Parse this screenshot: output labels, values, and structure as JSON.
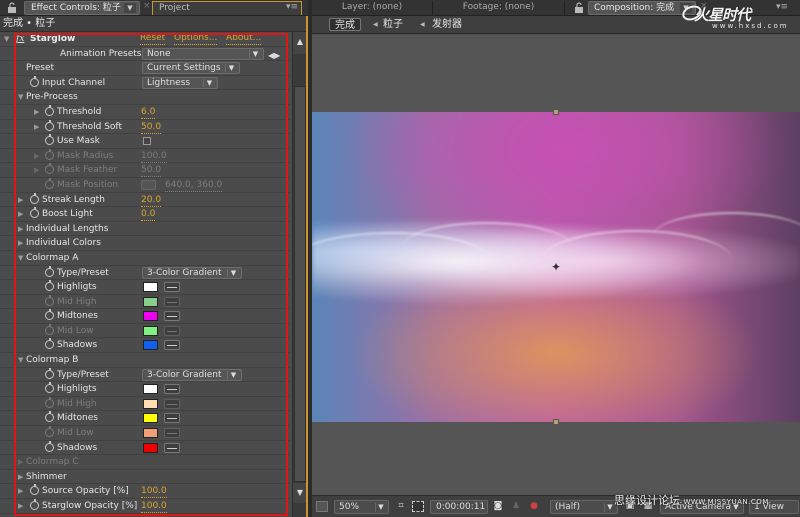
{
  "left_panel": {
    "tabs": [
      {
        "label": "Effect Controls: 粒子",
        "active": true
      },
      {
        "label": "Project",
        "active": false
      }
    ],
    "subtitle": "完成 • 粒子",
    "effect": {
      "name": "Starglow",
      "icon": "fx-icon",
      "links": {
        "reset": "Reset",
        "options": "Options...",
        "about": "About..."
      },
      "animation_presets": {
        "label": "Animation Presets:",
        "value": "None"
      },
      "preset": {
        "label": "Preset",
        "value": "Current Settings"
      },
      "input_channel": {
        "label": "Input Channel",
        "value": "Lightness"
      },
      "pre_process": {
        "label": "Pre-Process",
        "threshold": {
          "label": "Threshold",
          "value": "6.0"
        },
        "threshold_soft": {
          "label": "Threshold Soft",
          "value": "50.0"
        },
        "use_mask": {
          "label": "Use Mask",
          "checked": false
        },
        "mask_radius": {
          "label": "Mask Radius",
          "value": "100.0"
        },
        "mask_feather": {
          "label": "Mask Feather",
          "value": "50.0"
        },
        "mask_position": {
          "label": "Mask Position",
          "value": "640.0, 360.0"
        }
      },
      "streak_length": {
        "label": "Streak Length",
        "value": "20.0"
      },
      "boost_light": {
        "label": "Boost Light",
        "value": "0.0"
      },
      "individual_lengths": "Individual Lengths",
      "individual_colors": "Individual Colors",
      "colormap_a": {
        "label": "Colormap A",
        "type_preset": {
          "label": "Type/Preset",
          "value": "3-Color Gradient"
        },
        "highlights": {
          "label": "Highligts",
          "color": "#ffffff"
        },
        "mid_high": {
          "label": "Mid High",
          "color": "#88d08c"
        },
        "midtones": {
          "label": "Midtones",
          "color": "#f000f0"
        },
        "mid_low": {
          "label": "Mid Low",
          "color": "#80f080"
        },
        "shadows": {
          "label": "Shadows",
          "color": "#1060f0"
        }
      },
      "colormap_b": {
        "label": "Colormap B",
        "type_preset": {
          "label": "Type/Preset",
          "value": "3-Color Gradient"
        },
        "highlights": {
          "label": "Highligts",
          "color": "#ffffff"
        },
        "mid_high": {
          "label": "Mid High",
          "color": "#ffdcb4"
        },
        "midtones": {
          "label": "Midtones",
          "color": "#ffff00"
        },
        "mid_low": {
          "label": "Mid Low",
          "color": "#f0a078"
        },
        "shadows": {
          "label": "Shadows",
          "color": "#f00000"
        }
      },
      "colormap_c": "Colormap C",
      "shimmer": "Shimmer",
      "source_opacity": {
        "label": "Source Opacity [%]",
        "value": "100.0"
      },
      "starglow_opacity": {
        "label": "Starglow Opacity [%]",
        "value": "100.0"
      }
    }
  },
  "right_panel": {
    "tabs": [
      {
        "label": "Layer: (none)"
      },
      {
        "label": "Footage: (none)"
      },
      {
        "label": "Composition: 完成",
        "active": true
      }
    ],
    "breadcrumbs": [
      "完成",
      "粒子",
      "发射器"
    ],
    "watermark": {
      "brand": "火星时代",
      "url": "www.hxsd.com"
    },
    "footer_watermark": {
      "text": "思缘设计论坛",
      "url": "WWW.MISSYUAN.COM"
    },
    "toolbar": {
      "zoom": "50%",
      "timecode": "0:00:00:11",
      "resolution": "(Half)",
      "camera": "Active Camera",
      "views": "1 View"
    }
  },
  "colors": {
    "accent": "#e0a530",
    "panel_border": "#c8952e",
    "highlight_box": "#e01515"
  }
}
